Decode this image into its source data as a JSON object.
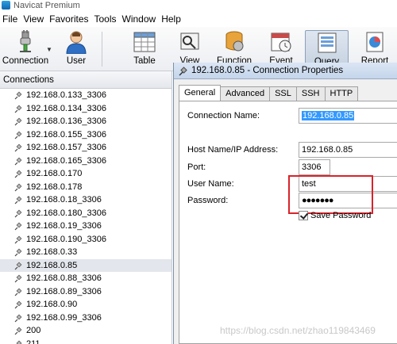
{
  "app": {
    "title": "Navicat Premium"
  },
  "menu": [
    "File",
    "View",
    "Favorites",
    "Tools",
    "Window",
    "Help"
  ],
  "toolbar": {
    "connection_label": "Connection",
    "user_label": "User",
    "table_label": "Table",
    "view_label": "View",
    "function_label": "Function",
    "event_label": "Event",
    "query_label": "Query",
    "report_label": "Report"
  },
  "connections": {
    "header": "Connections",
    "items": [
      "192.168.0.133_3306",
      "192.168.0.134_3306",
      "192.168.0.136_3306",
      "192.168.0.155_3306",
      "192.168.0.157_3306",
      "192.168.0.165_3306",
      "192.168.0.170",
      "192.168.0.178",
      "192.168.0.18_3306",
      "192.168.0.180_3306",
      "192.168.0.19_3306",
      "192.168.0.190_3306",
      "192.168.0.33",
      "192.168.0.85",
      "192.168.0.88_3306",
      "192.168.0.89_3306",
      "192.168.0.90",
      "192.168.0.99_3306",
      "200",
      "211"
    ],
    "selected": "192.168.0.85"
  },
  "dialog": {
    "title": "192.168.0.85 - Connection Properties",
    "tabs": [
      "General",
      "Advanced",
      "SSL",
      "SSH",
      "HTTP"
    ],
    "active_tab": "General",
    "connection_name_label": "Connection Name:",
    "connection_name_value": "192.168.0.85",
    "host_label": "Host Name/IP Address:",
    "host_value": "192.168.0.85",
    "port_label": "Port:",
    "port_value": "3306",
    "username_label": "User Name:",
    "username_value": "test",
    "password_label": "Password:",
    "password_value": "●●●●●●●",
    "save_password_label": "Save Password"
  },
  "watermark": "https://blog.csdn.net/zhao119843469",
  "colors": {
    "highlight": "#d8232a",
    "selection": "#3399ff"
  }
}
